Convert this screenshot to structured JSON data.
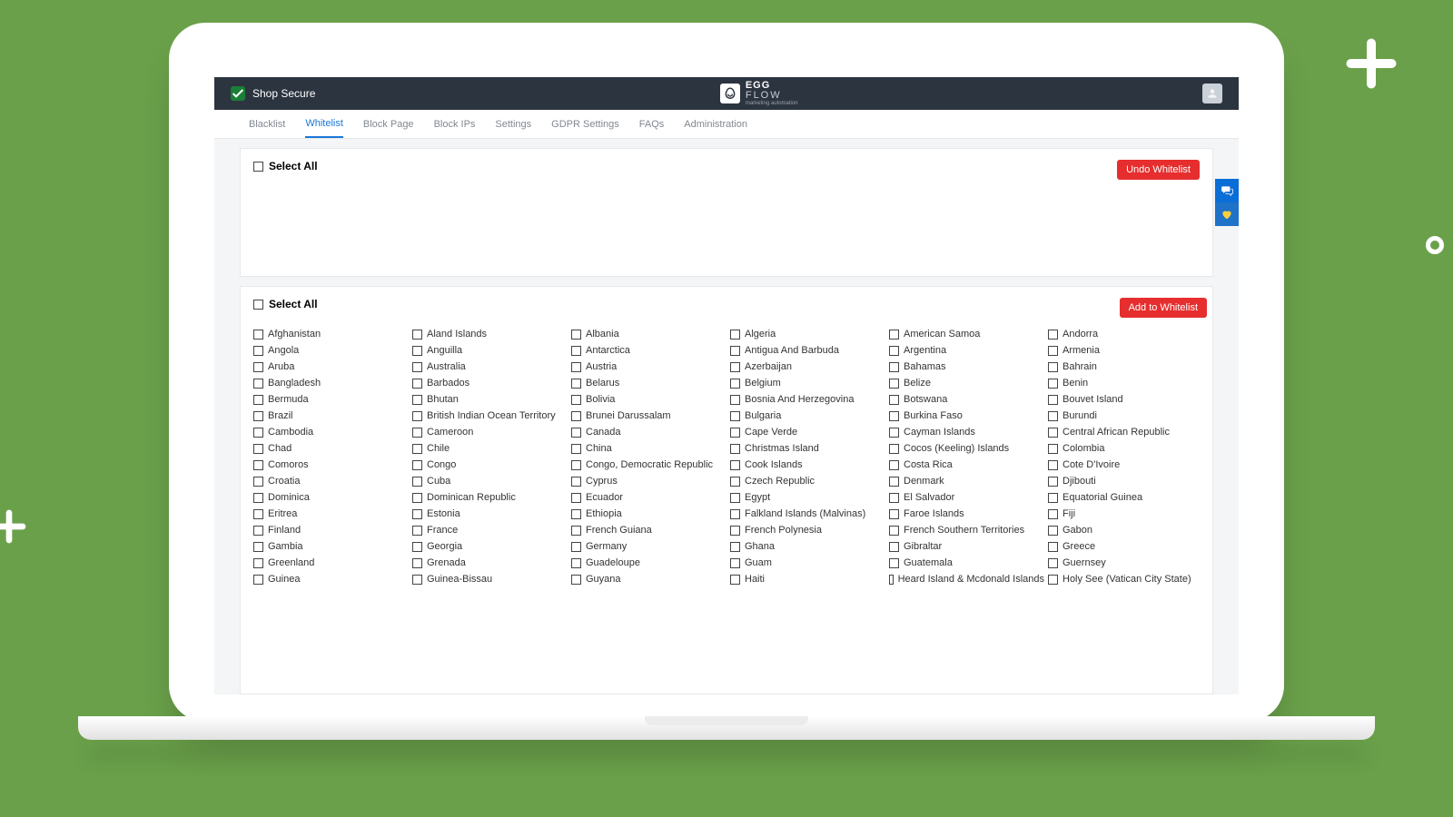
{
  "header": {
    "shop_name": "Shop Secure",
    "logo_top": "EGG",
    "logo_bottom": "FLOW",
    "logo_sub": "marketing automation"
  },
  "tabs": [
    {
      "label": "Blacklist",
      "active": false
    },
    {
      "label": "Whitelist",
      "active": true
    },
    {
      "label": "Block Page",
      "active": false
    },
    {
      "label": "Block IPs",
      "active": false
    },
    {
      "label": "Settings",
      "active": false
    },
    {
      "label": "GDPR Settings",
      "active": false
    },
    {
      "label": "FAQs",
      "active": false
    },
    {
      "label": "Administration",
      "active": false
    }
  ],
  "top_panel": {
    "select_all": "Select All",
    "undo_button": "Undo Whitelist"
  },
  "bottom_panel": {
    "select_all": "Select All",
    "add_button": "Add to Whitelist"
  },
  "countries": [
    "Afghanistan",
    "Aland Islands",
    "Albania",
    "Algeria",
    "American Samoa",
    "Andorra",
    "Angola",
    "Anguilla",
    "Antarctica",
    "Antigua And Barbuda",
    "Argentina",
    "Armenia",
    "Aruba",
    "Australia",
    "Austria",
    "Azerbaijan",
    "Bahamas",
    "Bahrain",
    "Bangladesh",
    "Barbados",
    "Belarus",
    "Belgium",
    "Belize",
    "Benin",
    "Bermuda",
    "Bhutan",
    "Bolivia",
    "Bosnia And Herzegovina",
    "Botswana",
    "Bouvet Island",
    "Brazil",
    "British Indian Ocean Territory",
    "Brunei Darussalam",
    "Bulgaria",
    "Burkina Faso",
    "Burundi",
    "Cambodia",
    "Cameroon",
    "Canada",
    "Cape Verde",
    "Cayman Islands",
    "Central African Republic",
    "Chad",
    "Chile",
    "China",
    "Christmas Island",
    "Cocos (Keeling) Islands",
    "Colombia",
    "Comoros",
    "Congo",
    "Congo, Democratic Republic",
    "Cook Islands",
    "Costa Rica",
    "Cote D'Ivoire",
    "Croatia",
    "Cuba",
    "Cyprus",
    "Czech Republic",
    "Denmark",
    "Djibouti",
    "Dominica",
    "Dominican Republic",
    "Ecuador",
    "Egypt",
    "El Salvador",
    "Equatorial Guinea",
    "Eritrea",
    "Estonia",
    "Ethiopia",
    "Falkland Islands (Malvinas)",
    "Faroe Islands",
    "Fiji",
    "Finland",
    "France",
    "French Guiana",
    "French Polynesia",
    "French Southern Territories",
    "Gabon",
    "Gambia",
    "Georgia",
    "Germany",
    "Ghana",
    "Gibraltar",
    "Greece",
    "Greenland",
    "Grenada",
    "Guadeloupe",
    "Guam",
    "Guatemala",
    "Guernsey",
    "Guinea",
    "Guinea-Bissau",
    "Guyana",
    "Haiti",
    "Heard Island & Mcdonald Islands",
    "Holy See (Vatican City State)"
  ]
}
